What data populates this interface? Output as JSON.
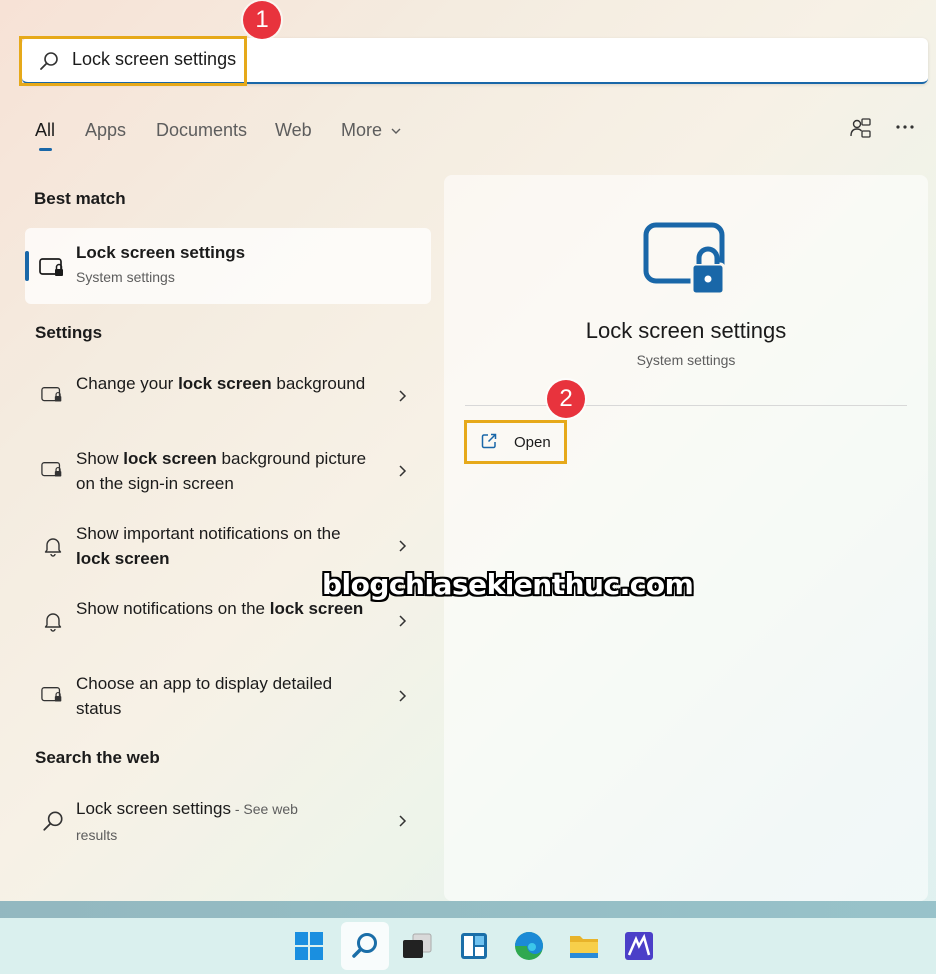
{
  "search": {
    "value": "Lock screen settings"
  },
  "badges": {
    "one": "1",
    "two": "2"
  },
  "tabs": [
    {
      "label": "All"
    },
    {
      "label": "Apps"
    },
    {
      "label": "Documents"
    },
    {
      "label": "Web"
    },
    {
      "label": "More"
    }
  ],
  "sections": {
    "best_match": "Best match",
    "settings": "Settings",
    "search_web": "Search the web"
  },
  "best_match": {
    "title": "Lock screen settings",
    "subtitle": "System settings"
  },
  "settings_items": [
    {
      "pre": "Change your ",
      "bold": "lock screen",
      "post": " background"
    },
    {
      "pre": "Show ",
      "bold": "lock screen",
      "post": " background picture on the sign-in screen"
    },
    {
      "pre": "Show important notifications on the ",
      "bold": "lock screen",
      "post": ""
    },
    {
      "pre": "Show notifications on the ",
      "bold": "lock screen",
      "post": ""
    },
    {
      "pre": "Choose an app to display detailed status",
      "bold": "",
      "post": ""
    }
  ],
  "web_item": {
    "title": "Lock screen settings",
    "suffix": " - See web results"
  },
  "detail": {
    "title": "Lock screen settings",
    "subtitle": "System settings",
    "open_label": "Open"
  },
  "watermark": "blogchiasekienthuc.com",
  "icons": {
    "search": "search-icon",
    "share": "share-icon",
    "more": "more-dots-icon",
    "lock_screen": "lock-screen-icon",
    "bell": "bell-icon",
    "open": "open-external-icon",
    "chevron": "chevron-right-icon"
  },
  "colors": {
    "accent": "#1967a8",
    "highlight": "#e6a91a",
    "badge": "#e8333d"
  }
}
